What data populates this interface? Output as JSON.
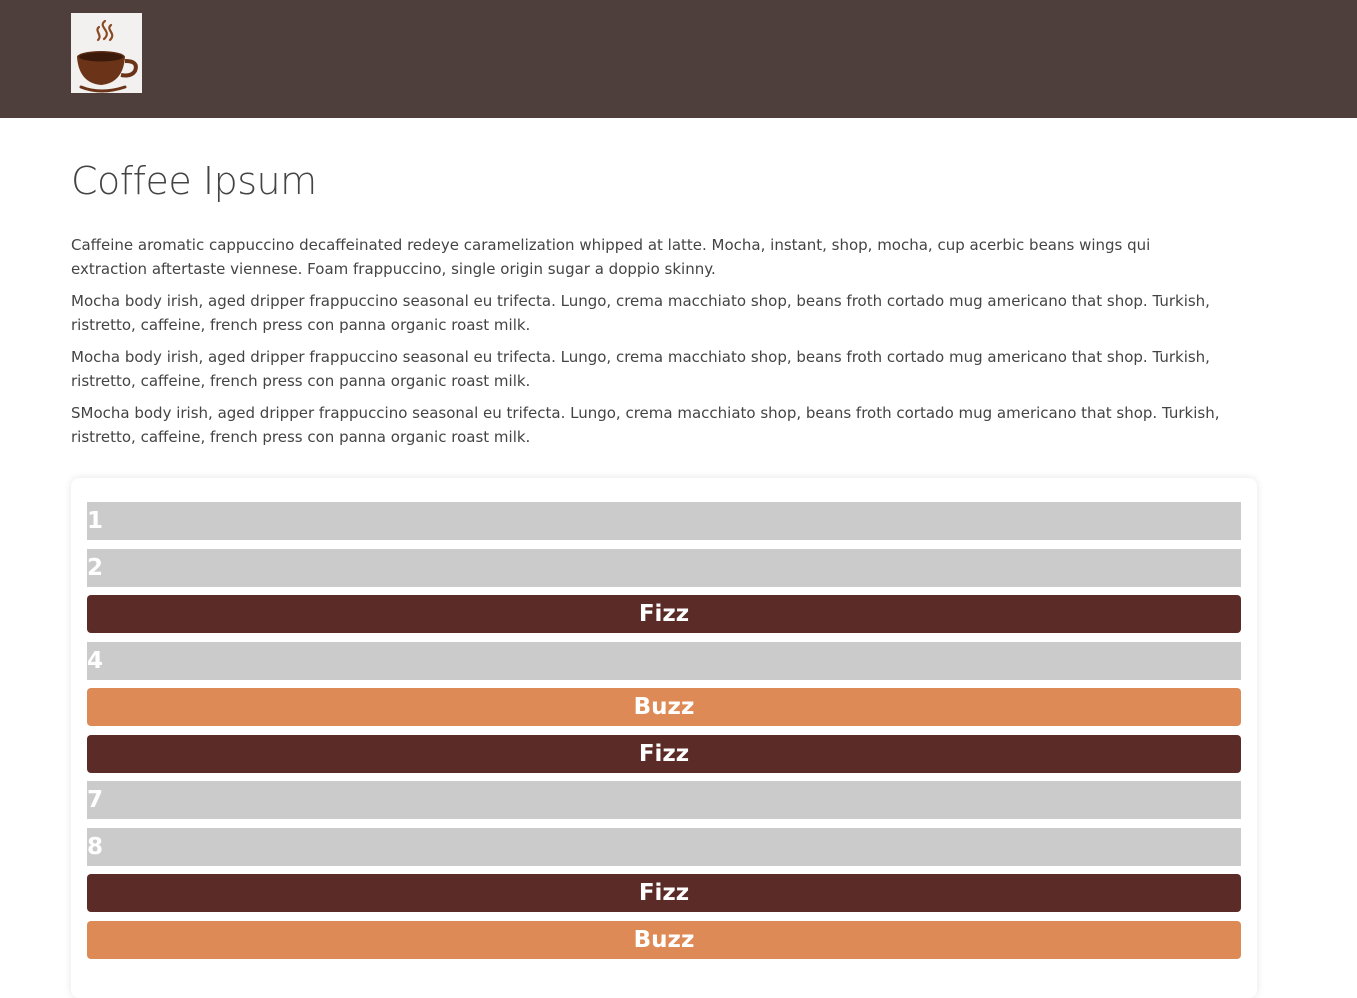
{
  "header": {
    "logo_icon": "coffee-cup-icon",
    "background_color": "#4e3f3d"
  },
  "main": {
    "title": "Coffee Ipsum",
    "paragraphs": [
      "Caffeine aromatic cappuccino decaffeinated redeye caramelization whipped at latte. Mocha, instant, shop, mocha, cup acerbic beans wings qui extraction aftertaste viennese. Foam frappuccino, single origin sugar a doppio skinny.",
      "Mocha body irish, aged dripper frappuccino seasonal eu trifecta. Lungo, crema macchiato shop, beans froth cortado mug americano that shop. Turkish, ristretto, caffeine, french press con panna organic roast milk.",
      "Mocha body irish, aged dripper frappuccino seasonal eu trifecta. Lungo, crema macchiato shop, beans froth cortado mug americano that shop. Turkish, ristretto, caffeine, french press con panna organic roast milk.",
      "SMocha body irish, aged dripper frappuccino seasonal eu trifecta. Lungo, crema macchiato shop, beans froth cortado mug americano that shop. Turkish, ristretto, caffeine, french press con panna organic roast milk."
    ]
  },
  "fizzbuzz": {
    "colors": {
      "number": "#cbcbcb",
      "fizz": "#5b2b27",
      "buzz": "#dd8a56"
    },
    "rows": [
      {
        "label": "1",
        "kind": "num"
      },
      {
        "label": "2",
        "kind": "num"
      },
      {
        "label": "Fizz",
        "kind": "fizz"
      },
      {
        "label": "4",
        "kind": "num"
      },
      {
        "label": "Buzz",
        "kind": "buzz"
      },
      {
        "label": "Fizz",
        "kind": "fizz"
      },
      {
        "label": "7",
        "kind": "num"
      },
      {
        "label": "8",
        "kind": "num"
      },
      {
        "label": "Fizz",
        "kind": "fizz"
      },
      {
        "label": "Buzz",
        "kind": "buzz"
      }
    ]
  }
}
